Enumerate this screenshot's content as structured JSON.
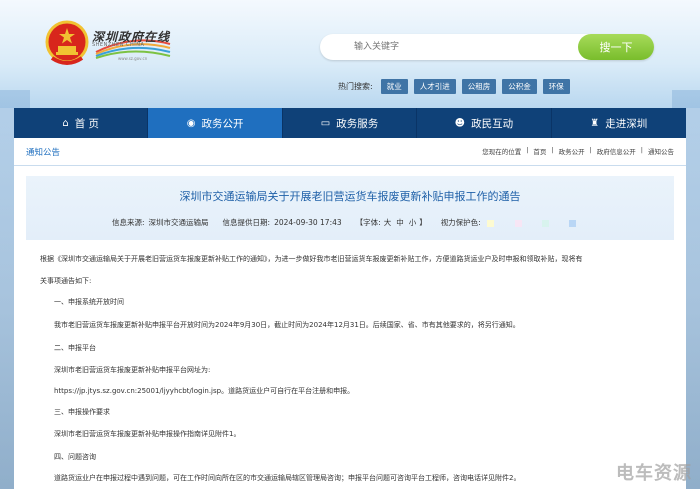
{
  "header": {
    "logo_text": "深圳政府在线",
    "logo_sub": "SHENZHEN CHINA",
    "logo_url": "www.sz.gov.cn"
  },
  "search": {
    "placeholder": "输入关键字",
    "button_label": "搜一下"
  },
  "hot_search": {
    "label": "热门搜索:",
    "tags": [
      "就业",
      "人才引进",
      "公租房",
      "公积金",
      "环保"
    ]
  },
  "nav": {
    "items": [
      {
        "label": "首 页",
        "icon": "home-icon"
      },
      {
        "label": "政务公开",
        "icon": "eye-icon"
      },
      {
        "label": "政务服务",
        "icon": "monitor-icon"
      },
      {
        "label": "政民互动",
        "icon": "users-icon"
      },
      {
        "label": "走进深圳",
        "icon": "tower-icon"
      }
    ],
    "active_index": 1
  },
  "breadcrumb": {
    "section_title": "通知公告",
    "path": [
      "您现在的位置",
      "首页",
      "政务公开",
      "政府信息公开",
      "通知公告"
    ]
  },
  "article": {
    "title": "深圳市交通运输局关于开展老旧营运货车报废更新补贴申报工作的通告",
    "source_label": "信息来源:",
    "source": "深圳市交通运输局",
    "date_label": "信息提供日期:",
    "date": "2024-09-30 17:43",
    "font_label": "【字体:",
    "font_sizes": [
      "大",
      "中",
      "小"
    ],
    "font_close": "】",
    "vision_label": "视力保护色:",
    "vision_colors": [
      "#fdfbd2",
      "#f7e6f5",
      "#d8f3ee",
      "#b9d6f5"
    ],
    "paragraphs": [
      "根据《深圳市交通运输局关于开展老旧营运货车报废更新补贴工作的通知》，为进一步做好我市老旧营运货车报废更新补贴工作，方便道路货运业户及时申报和领取补贴，现将有",
      "关事项通告如下:",
      "一、申报系统开放时间",
      "我市老旧营运货车报废更新补贴申报平台开放时间为2024年9月30日，截止时间为2024年12月31日。后续国家、省、市有其他要求的，将另行通知。",
      "二、申报平台",
      "深圳市老旧营运货车报废更新补贴申报平台网址为:",
      "https://jp.jtys.sz.gov.cn:25001/ljyyhcbt/login.jsp。道路货运业户可自行在平台注册和申报。",
      "三、申报操作要求",
      "深圳市老旧营运货车报废更新补贴申报操作指南详见附件1。",
      "四、问题咨询",
      "道路货运业户在申报过程中遇到问题，可在工作时间向所在区的市交通运输局辖区管理局咨询；申报平台问题可咨询平台工程师，咨询电话详见附件2。"
    ]
  },
  "watermark": "电车资源"
}
